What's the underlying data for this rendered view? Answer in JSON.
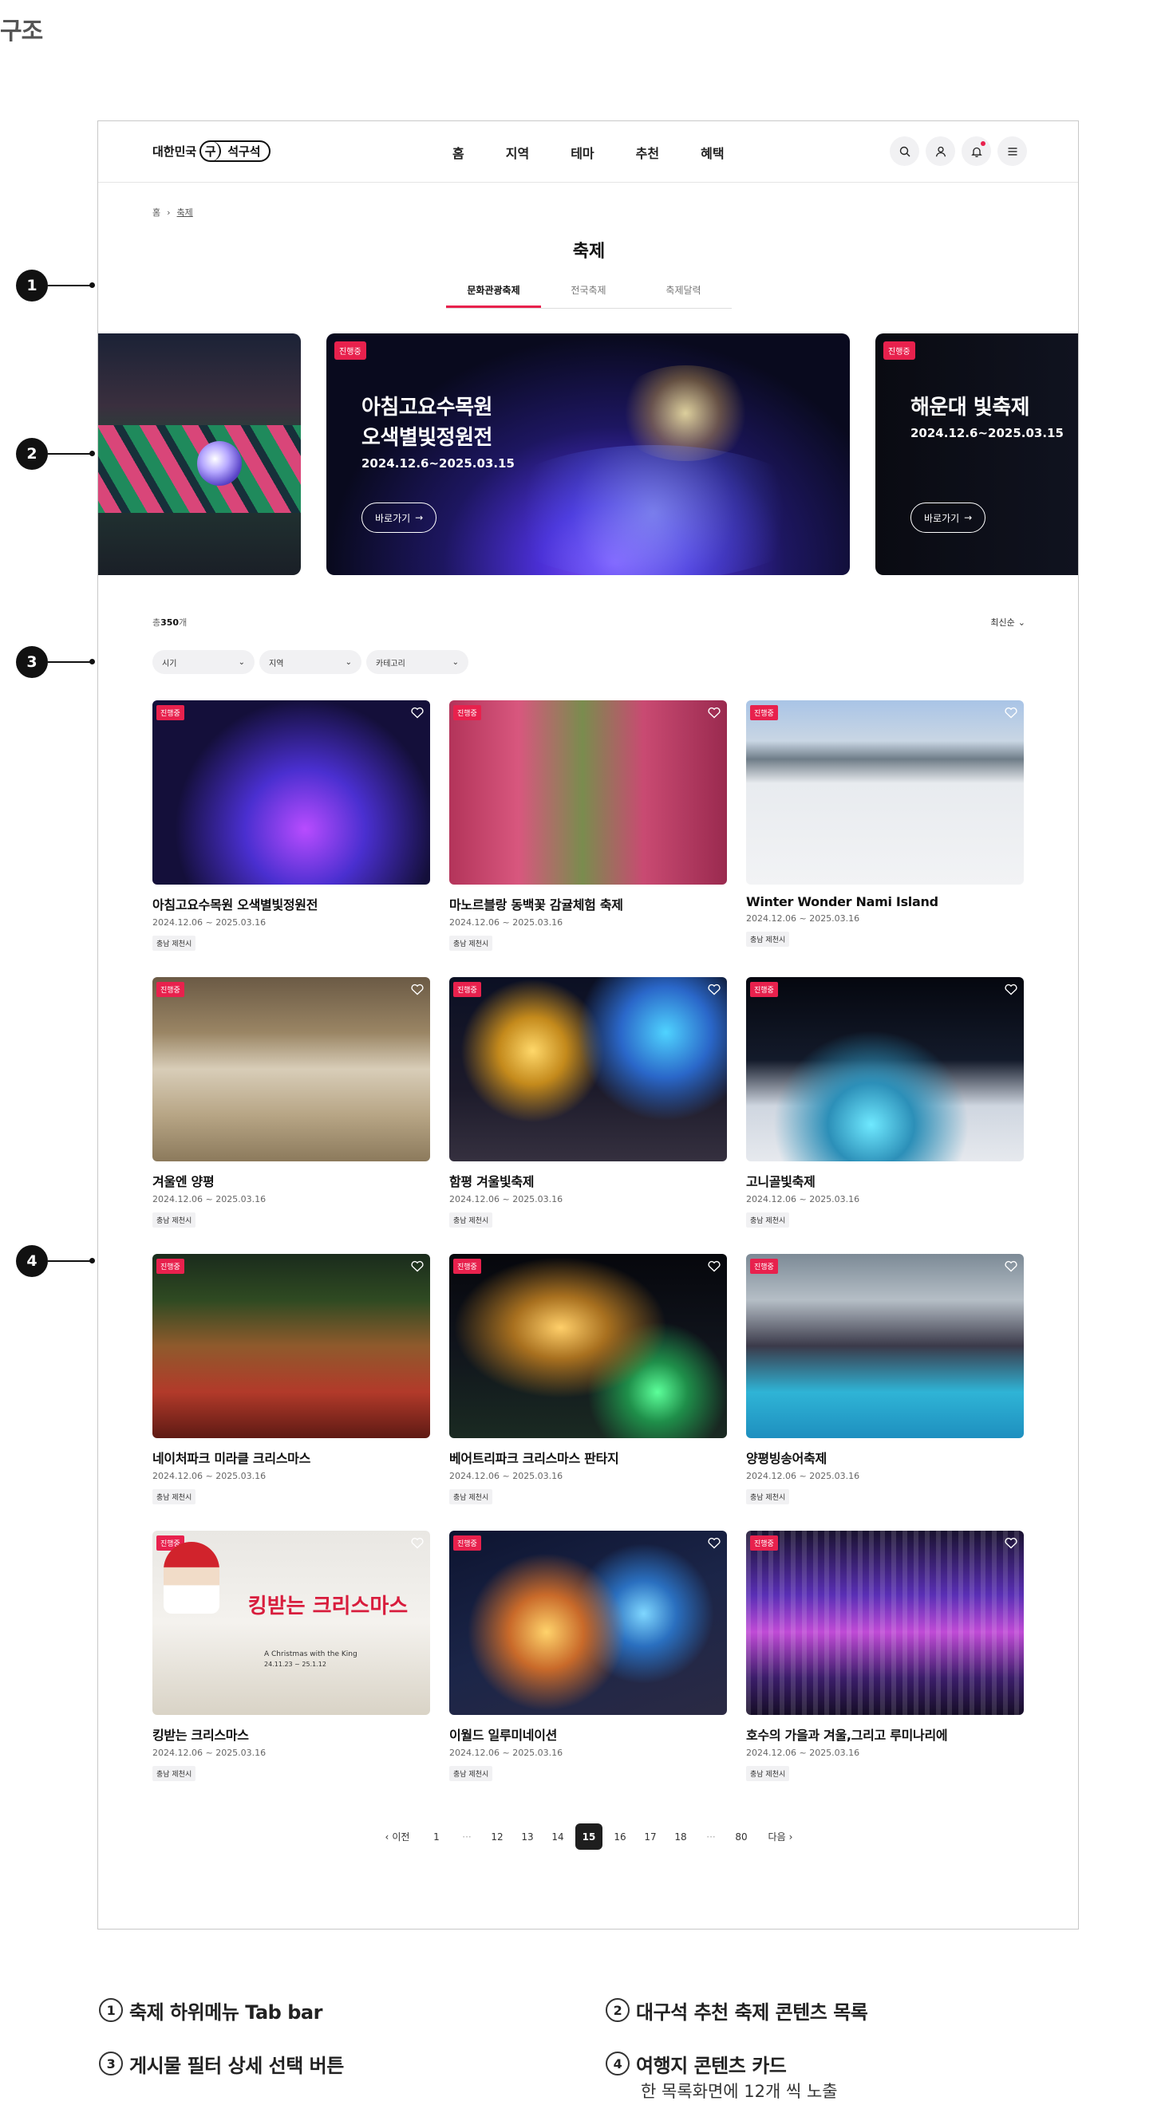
{
  "page_heading": "구조",
  "markers": [
    "1",
    "2",
    "3",
    "4"
  ],
  "header": {
    "logo_text": "대한민국",
    "logo_mark": "구",
    "logo_brand": "석구석",
    "nav": [
      "홈",
      "지역",
      "테마",
      "추천",
      "혜택"
    ],
    "icons": [
      "search-icon",
      "user-icon",
      "bell-icon",
      "menu-icon"
    ],
    "notification_color": "#e8214d"
  },
  "breadcrumb": {
    "home": "홈",
    "current": "축제"
  },
  "title": "축제",
  "tabs": [
    {
      "label": "문화관광축제",
      "active": true
    },
    {
      "label": "전국축제",
      "active": false
    },
    {
      "label": "축제달력",
      "active": false
    }
  ],
  "carousel": {
    "main": {
      "badge": "진행중",
      "title_line1": "아침고요수목원",
      "title_line2": "오색별빛정원전",
      "date": "2024.12.6~2025.03.15",
      "button": "바로가기"
    },
    "right": {
      "badge": "진행중",
      "title_line1": "해운대 빛축제",
      "date": "2024.12.6~2025.03.15",
      "button": "바로가기"
    }
  },
  "list": {
    "total_prefix": "총",
    "total_count": "350",
    "total_suffix": "개",
    "sort_label": "최신순",
    "filters": [
      "시기",
      "지역",
      "카테고리"
    ]
  },
  "cards": [
    {
      "badge": "진행중",
      "title": "아침고요수목원 오색별빛정원전",
      "date": "2024.12.06 ~ 2025.03.16",
      "tag": "충남 제천시"
    },
    {
      "badge": "진행중",
      "title": "마노르블랑 동백꽃 감귤체험 축제",
      "date": "2024.12.06 ~ 2025.03.16",
      "tag": "충남 제천시"
    },
    {
      "badge": "진행중",
      "title": "Winter Wonder Nami Island",
      "date": "2024.12.06 ~ 2025.03.16",
      "tag": "충남 제천시"
    },
    {
      "badge": "진행중",
      "title": "겨울엔 양평",
      "date": "2024.12.06 ~ 2025.03.16",
      "tag": "충남 제천시"
    },
    {
      "badge": "진행중",
      "title": "함평 겨울빛축제",
      "date": "2024.12.06 ~ 2025.03.16",
      "tag": "충남 제천시"
    },
    {
      "badge": "진행중",
      "title": "고니골빛축제",
      "date": "2024.12.06 ~ 2025.03.16",
      "tag": "충남 제천시"
    },
    {
      "badge": "진행중",
      "title": "네이처파크 미라클 크리스마스",
      "date": "2024.12.06 ~ 2025.03.16",
      "tag": "충남 제천시"
    },
    {
      "badge": "진행중",
      "title": "베어트리파크 크리스마스 판타지",
      "date": "2024.12.06 ~ 2025.03.16",
      "tag": "충남 제천시"
    },
    {
      "badge": "진행중",
      "title": "양평빙송어축제",
      "date": "2024.12.06 ~ 2025.03.16",
      "tag": "충남 제천시"
    },
    {
      "badge": "진행중",
      "title": "킹받는 크리스마스",
      "date": "2024.12.06 ~ 2025.03.16",
      "tag": "충남 제천시",
      "poster_text": "킹받는 크리스마스",
      "poster_sub": "A Christmas with the King",
      "poster_date": "24.11.23 ~ 25.1.12"
    },
    {
      "badge": "진행중",
      "title": "이월드 일루미네이션",
      "date": "2024.12.06 ~ 2025.03.16",
      "tag": "충남 제천시"
    },
    {
      "badge": "진행중",
      "title": "호수의 가을과 겨울,그리고 루미나리에",
      "date": "2024.12.06 ~ 2025.03.16",
      "tag": "충남 제천시"
    }
  ],
  "pagination": {
    "prev": "이전",
    "next": "다음",
    "pages": [
      "1",
      "···",
      "12",
      "13",
      "14",
      "15",
      "16",
      "17",
      "18",
      "···",
      "80"
    ],
    "current": "15"
  },
  "legend": [
    {
      "num": "1",
      "text": "축제 하위메뉴 Tab bar"
    },
    {
      "num": "2",
      "text": "대구석 추천 축제 콘텐츠 목록"
    },
    {
      "num": "3",
      "text": "게시물 필터 상세 선택 버튼"
    },
    {
      "num": "4",
      "text": "여행지 콘텐츠 카드",
      "sub": "한 목록화면에 12개 씩 노출"
    }
  ],
  "accent_color": "#e8214d"
}
